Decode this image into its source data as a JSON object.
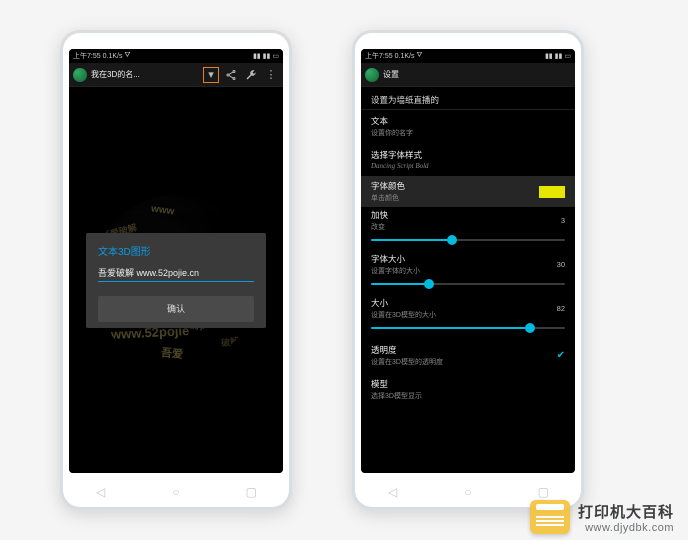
{
  "statusbar": {
    "time": "上午7:55",
    "net_speed": "0.1K/s",
    "wifi_icon": "wifi",
    "signal1": "sig",
    "signal2": "sig",
    "battery": "batt"
  },
  "left": {
    "app_title": "我在3D的名...",
    "icons": {
      "dropdown": "▾",
      "share": "⋔",
      "wrench": "🔧",
      "overflow": "⋮"
    },
    "sphere_text_sample": "吾爱破解",
    "dialog": {
      "title": "文本3D图形",
      "input_value": "吾爱破解 www.52pojie.cn",
      "confirm": "确认"
    }
  },
  "right": {
    "app_title": "设置",
    "section_header": "设置为墙纸直播的",
    "rows": {
      "text": {
        "title": "文本",
        "sub": "设置你的名字"
      },
      "font_style": {
        "title": "选择字体样式",
        "sub": "Dancing Script Bold"
      },
      "font_color": {
        "title": "字体颜色",
        "sub": "单击颜色",
        "swatch": "#e6e600"
      },
      "speed": {
        "title": "加快",
        "sub": "改变",
        "value": "3",
        "pct": 42
      },
      "font_size": {
        "title": "字体大小",
        "sub": "设置字体的大小",
        "value": "30",
        "pct": 30
      },
      "size": {
        "title": "大小",
        "sub": "设置在3D模型的大小",
        "value": "82",
        "pct": 82
      },
      "opacity": {
        "title": "透明度",
        "sub": "设置在3D模型的透明度",
        "checked": true
      },
      "model": {
        "title": "模型",
        "sub": "选择3D模型显示"
      }
    }
  },
  "nav": {
    "back": "◁",
    "home": "○",
    "recent": "▢"
  },
  "watermark": {
    "title": "打印机大百科",
    "url": "www.djydbk.com"
  }
}
